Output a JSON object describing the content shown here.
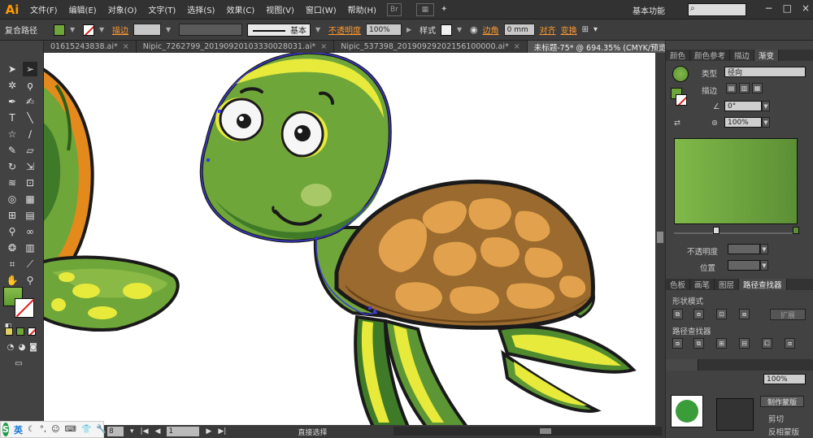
{
  "app": {
    "logo": "Ai"
  },
  "menu": [
    "文件(F)",
    "编辑(E)",
    "对象(O)",
    "文字(T)",
    "选择(S)",
    "效果(C)",
    "视图(V)",
    "窗口(W)",
    "帮助(H)"
  ],
  "menu_icon": "Br",
  "workspace": "基本功能",
  "window_controls": [
    "−",
    "□",
    "×"
  ],
  "control_bar": {
    "selection_label": "复合路径",
    "stroke_label": "描边",
    "stroke_style": "基本",
    "opacity_label": "不透明度",
    "opacity_value": "100%",
    "style_label": "样式",
    "corner_label": "边角",
    "corner_value": "0 mm",
    "align_label": "对齐",
    "transform_label": "变换"
  },
  "tabs": [
    {
      "label": "01615243838.ai*",
      "active": false
    },
    {
      "label": "Nipic_7262799_20190920103330028031.ai*",
      "active": false
    },
    {
      "label": "Nipic_537398_20190929202156100000.ai*",
      "active": false
    },
    {
      "label": "未标题-75* @ 694.35% (CMYK/预览)",
      "active": true
    }
  ],
  "status_bar": {
    "zoom": "8",
    "page": "1",
    "tool_name": "直接选择"
  },
  "ime": {
    "logo": "S",
    "lang": "英"
  },
  "right_panel": {
    "top_tabs": [
      "颜色",
      "颜色参考",
      "描边",
      "渐变"
    ],
    "gradient": {
      "type_label": "类型",
      "type_value": "径向",
      "stroke_label": "描边",
      "angle_value": "0°",
      "aspect_value": "100%",
      "opacity_label": "不透明度",
      "position_label": "位置",
      "start_color": "#80b949",
      "end_color": "#5c8f35"
    },
    "bottom_tabs": [
      "色板",
      "画笔",
      "图层",
      "路径查找器"
    ],
    "pathfinder": {
      "shape_modes_label": "形状模式",
      "expand_label": "扩展",
      "pathfinders_label": "路径查找器"
    },
    "transparency": {
      "opacity_value": "100%",
      "make_mask_label": "制作蒙版",
      "clip_label": "剪切",
      "invert_mask_label": "反相蒙版"
    }
  },
  "colors": {
    "turtle_green": "#6fa63a",
    "turtle_dark_green": "#3f7a28",
    "turtle_yellow": "#e7ea3a",
    "shell_brown": "#9a6a2e",
    "shell_plate": "#e2a24d",
    "outline": "#1a1a1a",
    "selection_path": "#3b3bd4"
  }
}
